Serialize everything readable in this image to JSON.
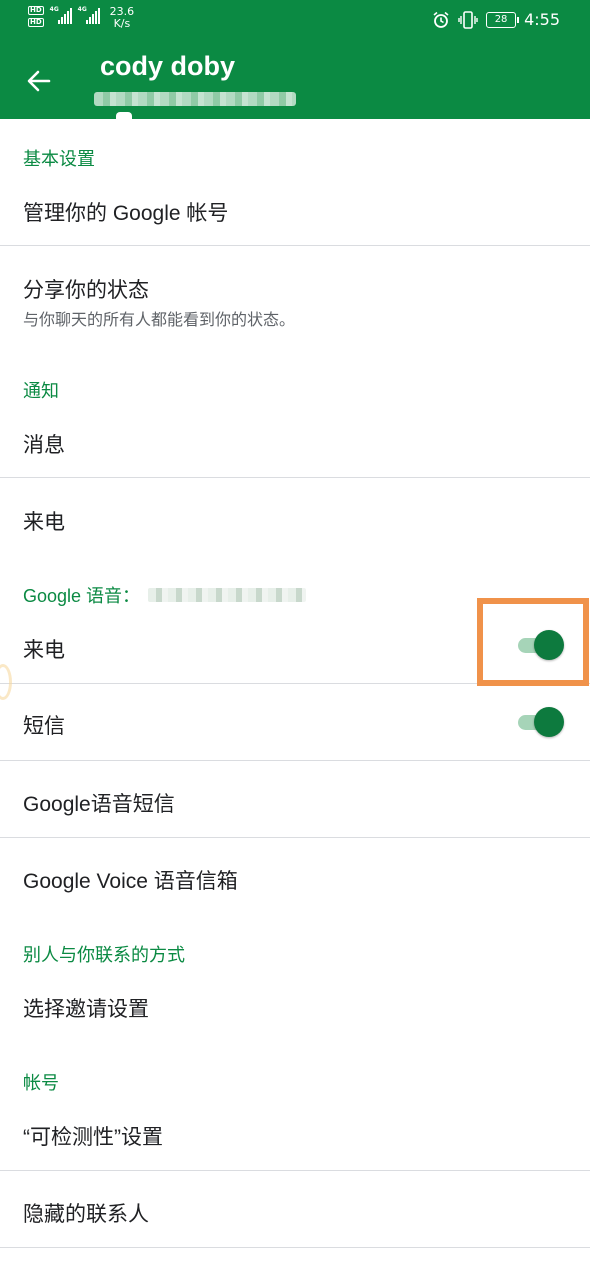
{
  "status_bar": {
    "hd1": "HD",
    "hd2": "HD",
    "sim1_label": "4G",
    "sim2_label": "4G",
    "speed_value": "23.6",
    "speed_unit": "K/s",
    "battery": "28",
    "time": "4:55",
    "icons": [
      "alarm-icon",
      "vibrate-icon",
      "battery-icon"
    ]
  },
  "app_bar": {
    "title": "cody doby",
    "back_icon": "arrow-back-icon"
  },
  "sections": {
    "basic": {
      "header": "基本设置",
      "items": [
        "管理你的 Google 帐号",
        "分享你的状态"
      ],
      "share_status_desc": "与你聊天的所有人都能看到你的状态。"
    },
    "notifications": {
      "header": "通知",
      "items": [
        "消息",
        "来电"
      ]
    },
    "google_voice": {
      "header": "Google 语音：",
      "calls_label": "来电",
      "calls_enabled": true,
      "sms_label": "短信",
      "sms_enabled": true,
      "voice_sms_label": "Google语音短信",
      "voicemail_label": "Google Voice 语音信箱"
    },
    "contact": {
      "header": "别人与你联系的方式",
      "items": [
        "选择邀请设置"
      ]
    },
    "account": {
      "header": "帐号",
      "items": [
        "“可检测性”设置",
        "隐藏的联系人"
      ]
    }
  },
  "colors": {
    "primary": "#0b8a43",
    "toggle_knob": "#0d7a3e",
    "toggle_track": "#a6d4b8",
    "highlight": "#f0924a"
  }
}
